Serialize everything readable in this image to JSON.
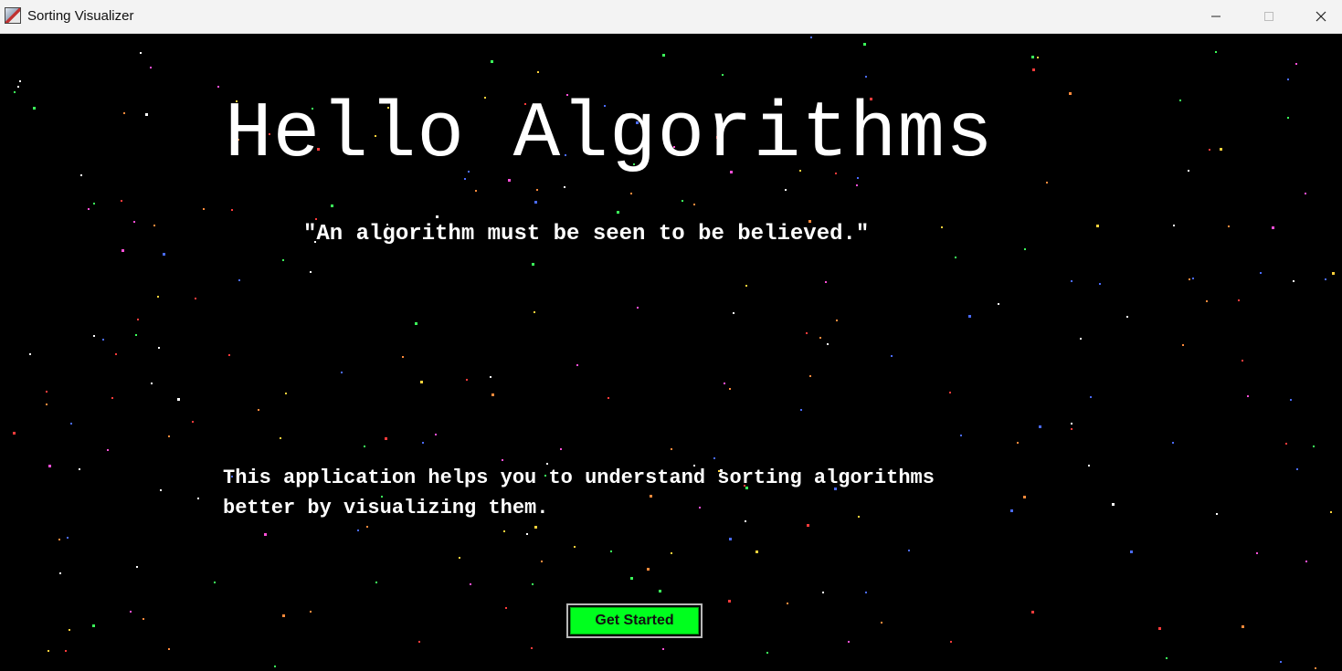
{
  "window": {
    "title": "Sorting Visualizer",
    "controls": {
      "minimize": "minimize-icon",
      "maximize": "maximize-icon",
      "close": "close-icon"
    }
  },
  "hero": {
    "headline": "Hello Algorithms",
    "quote": "\"An algorithm must be seen to be believed.\"",
    "description_lines": [
      "This application helps you to understand sorting algorithms",
      "better by visualizing them."
    ],
    "cta_label": "Get Started"
  },
  "colors": {
    "background": "#000000",
    "text": "#ffffff",
    "cta_background": "#00ff1e",
    "titlebar": "#f3f3f3",
    "star_palette": [
      "#ffffff",
      "#ff3b3b",
      "#3bff5a",
      "#4a6bff",
      "#ffd23b",
      "#ff4fd8",
      "#ff8a3b"
    ]
  }
}
